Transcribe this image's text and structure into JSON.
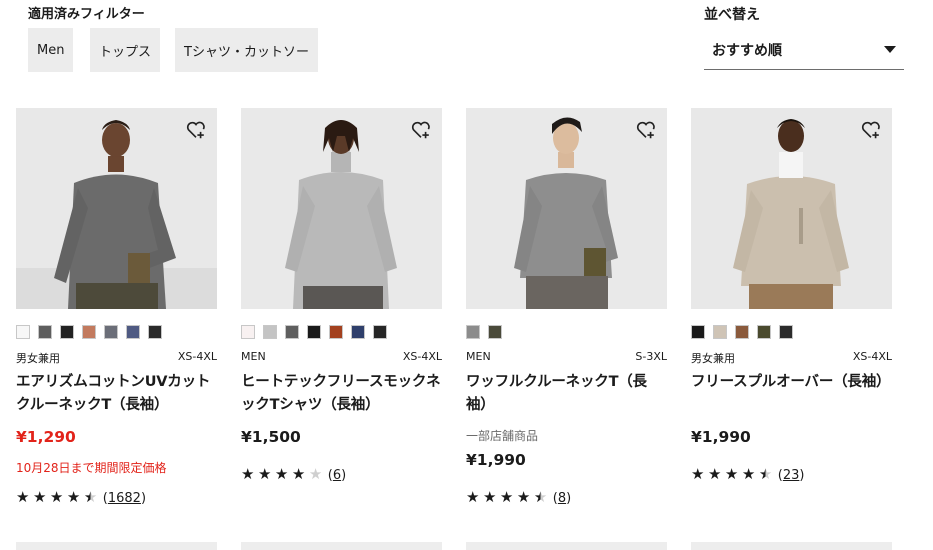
{
  "filters": {
    "title": "適用済みフィルター",
    "chips": [
      "Men",
      "トップス",
      "Tシャツ・カットソー"
    ]
  },
  "sort": {
    "title": "並べ替え",
    "value": "おすすめ順"
  },
  "products": [
    {
      "colors": [
        "#f7f7f7",
        "#5e5e5e",
        "#222222",
        "#c27a5e",
        "#6b6e78",
        "#4f5a82",
        "#2a2a2a"
      ],
      "gender": "男女兼用",
      "sizes": "XS-4XL",
      "name": "エアリズムコットンUVカットクルーネックT（長袖）",
      "price": "¥1,290",
      "sale": true,
      "promo": "10月28日まで期間限定価格",
      "rating": 4.5,
      "reviews": "1682"
    },
    {
      "colors": [
        "#f8f1f1",
        "#c4c4c4",
        "#5f5f5f",
        "#1a1a1a",
        "#a3411f",
        "#2f3f6b",
        "#262626"
      ],
      "gender": "MEN",
      "sizes": "XS-4XL",
      "name": "ヒートテックフリースモックネックTシャツ（長袖）",
      "price": "¥1,500",
      "sale": false,
      "rating": 4,
      "reviews": "6"
    },
    {
      "colors": [
        "#8c8c8c",
        "#4a4a3a"
      ],
      "gender": "MEN",
      "sizes": "S-3XL",
      "name": "ワッフルクルーネックT（長袖）",
      "note": "一部店舗商品",
      "price": "¥1,990",
      "sale": false,
      "rating": 4.5,
      "reviews": "8"
    },
    {
      "colors": [
        "#1a1a1a",
        "#cfc4b6",
        "#8a5a3c",
        "#4a4a2e",
        "#2b2b2b"
      ],
      "gender": "男女兼用",
      "sizes": "XS-4XL",
      "name": "フリースプルオーバー（長袖）",
      "price": "¥1,990",
      "sale": false,
      "rating": 4.5,
      "reviews": "23"
    }
  ]
}
